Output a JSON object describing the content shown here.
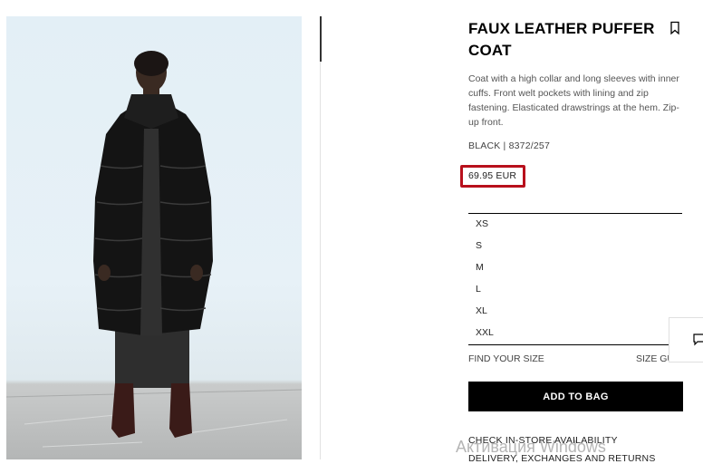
{
  "product": {
    "title": "FAUX LEATHER PUFFER COAT",
    "description": "Coat with a high collar and long sleeves with inner cuffs. Front welt pockets with lining and zip fastening. Elasticated drawstrings at the hem. Zip-up front.",
    "color_ref": "BLACK | 8372/257",
    "price": "69.95 EUR",
    "highlight_color": "#b8101c"
  },
  "sizes": [
    "XS",
    "S",
    "M",
    "L",
    "XL",
    "XXL"
  ],
  "actions": {
    "find_size": "FIND YOUR SIZE",
    "size_guide": "SIZE GU",
    "add_to_bag": "ADD TO BAG",
    "check_store": "CHECK IN-STORE AVAILABILITY",
    "delivery": "DELIVERY, EXCHANGES AND RETURNS"
  },
  "icons": {
    "bookmark": "bookmark-icon",
    "chat": "chat-icon"
  },
  "overlay": {
    "watermark": "Активация Windows"
  }
}
